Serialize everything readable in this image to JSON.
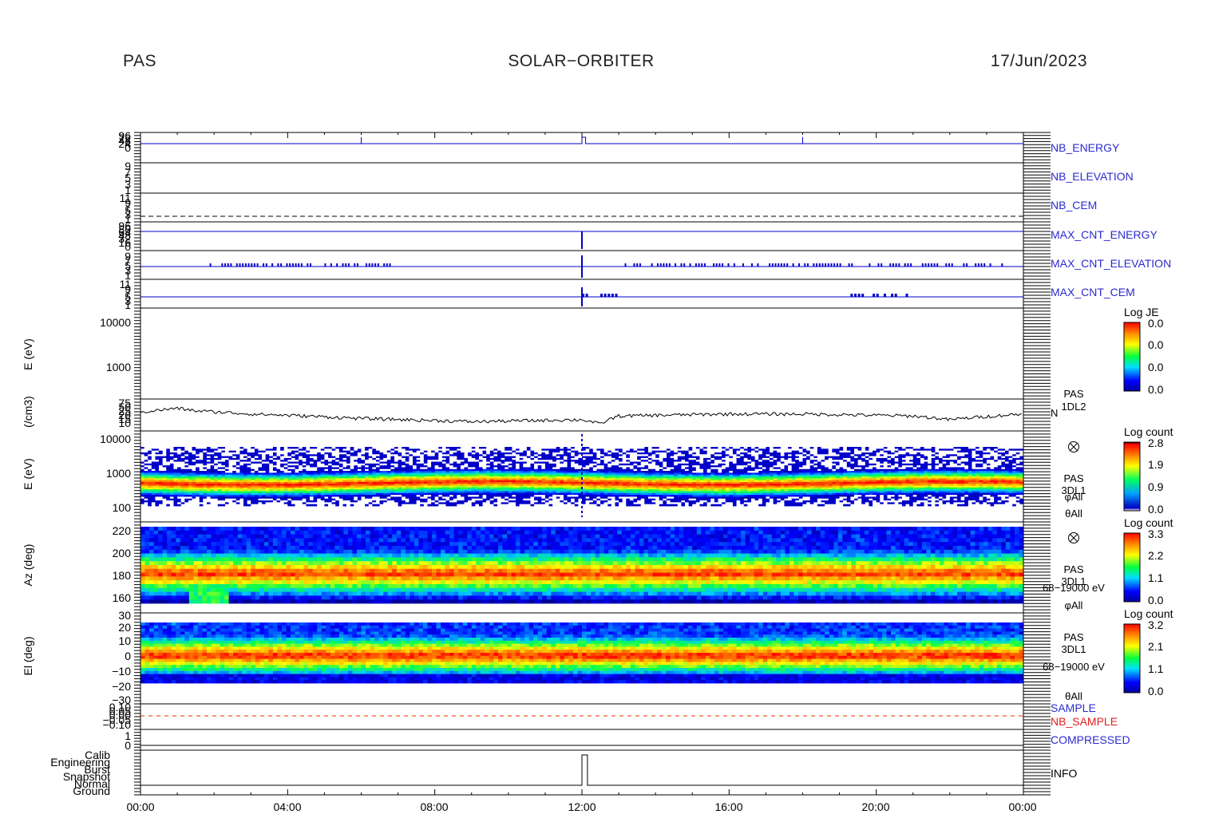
{
  "header": {
    "left": "PAS",
    "center": "SOLAR−ORBITER",
    "right": "17/Jun/2023"
  },
  "colors": {
    "blue_trace": "#0000cc",
    "black_trace": "#000000",
    "red_trace": "#ff2a00",
    "label_blue": "#2b2bd0",
    "label_red": "#e02020"
  },
  "time_axis": {
    "ticks": [
      "00:00",
      "04:00",
      "08:00",
      "12:00",
      "16:00",
      "20:00",
      "00:00"
    ]
  },
  "panels": {
    "nb_energy": {
      "label": "NB_ENERGY",
      "ticks": [
        "96",
        "72",
        "48",
        "24",
        "0"
      ]
    },
    "nb_elevation": {
      "label": "NB_ELEVATION",
      "ticks": [
        "9",
        "7",
        "5",
        "3",
        "1"
      ]
    },
    "nb_cem": {
      "label": "NB_CEM",
      "ticks": [
        "11",
        "9",
        "7",
        "5",
        "3",
        "1"
      ]
    },
    "max_cnt_energy": {
      "label": "MAX_CNT_ENERGY",
      "ticks": [
        "96",
        "80",
        "64",
        "48",
        "32",
        "16",
        "0"
      ]
    },
    "max_cnt_elevation": {
      "label": "MAX_CNT_ELEVATION",
      "ticks": [
        "9",
        "7",
        "5",
        "3",
        "1"
      ]
    },
    "max_cnt_cem": {
      "label": "MAX_CNT_CEM",
      "ticks": [
        "11",
        "9",
        "7",
        "5",
        "3",
        "1"
      ]
    },
    "energy_je": {
      "ylabel": "E (eV)",
      "ticks": [
        "10000",
        "1000"
      ],
      "colorbar_title": "Log JE",
      "colorbar_ticks": [
        "0.0",
        "0.0",
        "0.0",
        "0.0"
      ]
    },
    "density": {
      "ylabel": "(/cm3)",
      "ticks": [
        "75",
        "50",
        "25",
        "20",
        "15",
        "10"
      ],
      "right_lines": [
        "PAS",
        "1DL2"
      ],
      "trace_label": "N"
    },
    "energy_3d": {
      "ylabel": "E (eV)",
      "ticks": [
        "10000",
        "1000",
        "100"
      ],
      "colorbar_title": "Log count",
      "colorbar_ticks": [
        "2.8",
        "1.9",
        "0.9",
        "0.0"
      ],
      "right_lines": [
        "PAS",
        "3DL1",
        "φAll",
        "θAll"
      ]
    },
    "azimuth": {
      "ylabel": "Az (deg)",
      "ticks": [
        "220",
        "200",
        "180",
        "160"
      ],
      "colorbar_title": "Log count",
      "colorbar_ticks": [
        "3.3",
        "2.2",
        "1.1",
        "0.0"
      ],
      "right_lines": [
        "PAS",
        "3DL1",
        "68−19000 eV",
        "φAll"
      ]
    },
    "elevation": {
      "ylabel": "El (deg)",
      "ticks": [
        "30",
        "20",
        "10",
        "0",
        "−10",
        "−20",
        "−30"
      ],
      "colorbar_title": "Log count",
      "colorbar_ticks": [
        "3.2",
        "2.1",
        "1.1",
        "0.0"
      ],
      "right_lines": [
        "PAS",
        "3DL1",
        "68−19000 eV",
        "θAll"
      ]
    },
    "sample": {
      "ticks": [
        "0.10",
        "0.05",
        "0.00",
        "−0.05",
        "−0.10"
      ],
      "labels": [
        "SAMPLE",
        "NB_SAMPLE"
      ]
    },
    "compressed": {
      "label": "COMPRESSED",
      "ticks": [
        "1",
        "0"
      ]
    },
    "info": {
      "label": "INFO",
      "ticks": [
        "Calib",
        "Engineering",
        "Burst",
        "Snapshot",
        "Normal",
        "Ground"
      ]
    }
  },
  "chart_data": [
    {
      "type": "line",
      "name": "NB_ENERGY",
      "x": [
        "00:00",
        "06:00",
        "12:00",
        "12:05",
        "18:00",
        "24:00"
      ],
      "y": [
        0,
        0,
        24,
        0,
        0,
        0
      ],
      "ylim": [
        0,
        96
      ]
    },
    {
      "type": "line",
      "name": "NB_CEM",
      "x": [
        "00:00",
        "24:00"
      ],
      "y": [
        3,
        3
      ],
      "ylim": [
        1,
        11
      ]
    },
    {
      "type": "line",
      "name": "MAX_CNT_ENERGY",
      "x": [
        "00:00",
        "12:00",
        "24:00"
      ],
      "y": [
        64,
        64,
        64
      ],
      "ylim": [
        0,
        96
      ]
    },
    {
      "type": "line",
      "name": "N",
      "x": [
        "00:00",
        "01:00",
        "01:30",
        "03:00",
        "06:00",
        "09:00",
        "12:00",
        "12:30",
        "13:00",
        "16:00",
        "18:00",
        "21:00",
        "22:00",
        "24:00"
      ],
      "y": [
        35,
        50,
        40,
        30,
        20,
        15,
        18,
        12,
        25,
        30,
        30,
        25,
        18,
        30
      ],
      "ylim": [
        10,
        75
      ]
    },
    {
      "type": "heatmap",
      "name": "3DL1 energy spectrogram",
      "x_range": [
        "00:00",
        "24:00"
      ],
      "peak_energy_eV": 500,
      "ylim": [
        100,
        10000
      ],
      "zlim": [
        0.0,
        2.8
      ]
    },
    {
      "type": "heatmap",
      "name": "Az spectrogram",
      "x_range": [
        "00:00",
        "24:00"
      ],
      "peak_az_deg": 182,
      "ylim": [
        150,
        225
      ],
      "zlim": [
        0.0,
        3.3
      ]
    },
    {
      "type": "heatmap",
      "name": "El spectrogram",
      "x_range": [
        "00:00",
        "24:00"
      ],
      "peak_el_deg": 2,
      "ylim": [
        -30,
        30
      ],
      "zlim": [
        0.0,
        3.2
      ]
    },
    {
      "type": "line",
      "name": "INFO",
      "x": [
        "00:00",
        "12:00",
        "12:10",
        "24:00"
      ],
      "y": [
        "Normal",
        "Calib",
        "Normal",
        "Normal"
      ]
    }
  ]
}
